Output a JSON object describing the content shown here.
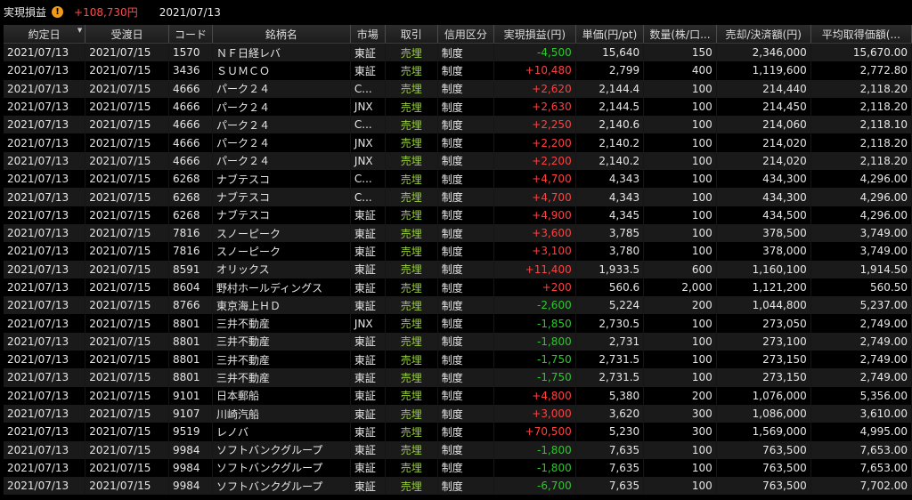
{
  "header": {
    "title": "実現損益",
    "warning_icon": "warning-icon",
    "total_pnl": "+108,730円",
    "date": "2021/07/13"
  },
  "colors": {
    "positive": "#ff4040",
    "negative": "#2fc62f",
    "sell": "#9bcf3a",
    "warning": "#f29a1a"
  },
  "table": {
    "columns": [
      "約定日",
      "受渡日",
      "コード",
      "銘柄名",
      "市場",
      "取引",
      "信用区分",
      "実現損益(円)",
      "単価(円/pt)",
      "数量(株/口...",
      "売却/決済額(円)",
      "平均取得価額(..."
    ],
    "rows": [
      [
        "2021/07/13",
        "2021/07/15",
        "1570",
        "ＮＦ日経レバ",
        "東証",
        "売埋",
        "制度",
        "-4,500",
        "15,640",
        "150",
        "2,346,000",
        "15,670.00"
      ],
      [
        "2021/07/13",
        "2021/07/15",
        "3436",
        "ＳＵＭＣＯ",
        "東証",
        "売埋",
        "制度",
        "+10,480",
        "2,799",
        "400",
        "1,119,600",
        "2,772.80"
      ],
      [
        "2021/07/13",
        "2021/07/15",
        "4666",
        "パーク２４",
        "C...",
        "売埋",
        "制度",
        "+2,620",
        "2,144.4",
        "100",
        "214,440",
        "2,118.20"
      ],
      [
        "2021/07/13",
        "2021/07/15",
        "4666",
        "パーク２４",
        "JNX",
        "売埋",
        "制度",
        "+2,630",
        "2,144.5",
        "100",
        "214,450",
        "2,118.20"
      ],
      [
        "2021/07/13",
        "2021/07/15",
        "4666",
        "パーク２４",
        "C...",
        "売埋",
        "制度",
        "+2,250",
        "2,140.6",
        "100",
        "214,060",
        "2,118.10"
      ],
      [
        "2021/07/13",
        "2021/07/15",
        "4666",
        "パーク２４",
        "JNX",
        "売埋",
        "制度",
        "+2,200",
        "2,140.2",
        "100",
        "214,020",
        "2,118.20"
      ],
      [
        "2021/07/13",
        "2021/07/15",
        "4666",
        "パーク２４",
        "JNX",
        "売埋",
        "制度",
        "+2,200",
        "2,140.2",
        "100",
        "214,020",
        "2,118.20"
      ],
      [
        "2021/07/13",
        "2021/07/15",
        "6268",
        "ナブテスコ",
        "C...",
        "売埋",
        "制度",
        "+4,700",
        "4,343",
        "100",
        "434,300",
        "4,296.00"
      ],
      [
        "2021/07/13",
        "2021/07/15",
        "6268",
        "ナブテスコ",
        "C...",
        "売埋",
        "制度",
        "+4,700",
        "4,343",
        "100",
        "434,300",
        "4,296.00"
      ],
      [
        "2021/07/13",
        "2021/07/15",
        "6268",
        "ナブテスコ",
        "東証",
        "売埋",
        "制度",
        "+4,900",
        "4,345",
        "100",
        "434,500",
        "4,296.00"
      ],
      [
        "2021/07/13",
        "2021/07/15",
        "7816",
        "スノーピーク",
        "東証",
        "売埋",
        "制度",
        "+3,600",
        "3,785",
        "100",
        "378,500",
        "3,749.00"
      ],
      [
        "2021/07/13",
        "2021/07/15",
        "7816",
        "スノーピーク",
        "東証",
        "売埋",
        "制度",
        "+3,100",
        "3,780",
        "100",
        "378,000",
        "3,749.00"
      ],
      [
        "2021/07/13",
        "2021/07/15",
        "8591",
        "オリックス",
        "東証",
        "売埋",
        "制度",
        "+11,400",
        "1,933.5",
        "600",
        "1,160,100",
        "1,914.50"
      ],
      [
        "2021/07/13",
        "2021/07/15",
        "8604",
        "野村ホールディングス",
        "東証",
        "売埋",
        "制度",
        "+200",
        "560.6",
        "2,000",
        "1,121,200",
        "560.50"
      ],
      [
        "2021/07/13",
        "2021/07/15",
        "8766",
        "東京海上ＨＤ",
        "東証",
        "売埋",
        "制度",
        "-2,600",
        "5,224",
        "200",
        "1,044,800",
        "5,237.00"
      ],
      [
        "2021/07/13",
        "2021/07/15",
        "8801",
        "三井不動産",
        "JNX",
        "売埋",
        "制度",
        "-1,850",
        "2,730.5",
        "100",
        "273,050",
        "2,749.00"
      ],
      [
        "2021/07/13",
        "2021/07/15",
        "8801",
        "三井不動産",
        "東証",
        "売埋",
        "制度",
        "-1,800",
        "2,731",
        "100",
        "273,100",
        "2,749.00"
      ],
      [
        "2021/07/13",
        "2021/07/15",
        "8801",
        "三井不動産",
        "東証",
        "売埋",
        "制度",
        "-1,750",
        "2,731.5",
        "100",
        "273,150",
        "2,749.00"
      ],
      [
        "2021/07/13",
        "2021/07/15",
        "8801",
        "三井不動産",
        "東証",
        "売埋",
        "制度",
        "-1,750",
        "2,731.5",
        "100",
        "273,150",
        "2,749.00"
      ],
      [
        "2021/07/13",
        "2021/07/15",
        "9101",
        "日本郵船",
        "東証",
        "売埋",
        "制度",
        "+4,800",
        "5,380",
        "200",
        "1,076,000",
        "5,356.00"
      ],
      [
        "2021/07/13",
        "2021/07/15",
        "9107",
        "川崎汽船",
        "東証",
        "売埋",
        "制度",
        "+3,000",
        "3,620",
        "300",
        "1,086,000",
        "3,610.00"
      ],
      [
        "2021/07/13",
        "2021/07/15",
        "9519",
        "レノバ",
        "東証",
        "売埋",
        "制度",
        "+70,500",
        "5,230",
        "300",
        "1,569,000",
        "4,995.00"
      ],
      [
        "2021/07/13",
        "2021/07/15",
        "9984",
        "ソフトバンクグループ",
        "東証",
        "売埋",
        "制度",
        "-1,800",
        "7,635",
        "100",
        "763,500",
        "7,653.00"
      ],
      [
        "2021/07/13",
        "2021/07/15",
        "9984",
        "ソフトバンクグループ",
        "東証",
        "売埋",
        "制度",
        "-1,800",
        "7,635",
        "100",
        "763,500",
        "7,653.00"
      ],
      [
        "2021/07/13",
        "2021/07/15",
        "9984",
        "ソフトバンクグループ",
        "東証",
        "売埋",
        "制度",
        "-6,700",
        "7,635",
        "100",
        "763,500",
        "7,702.00"
      ]
    ]
  }
}
